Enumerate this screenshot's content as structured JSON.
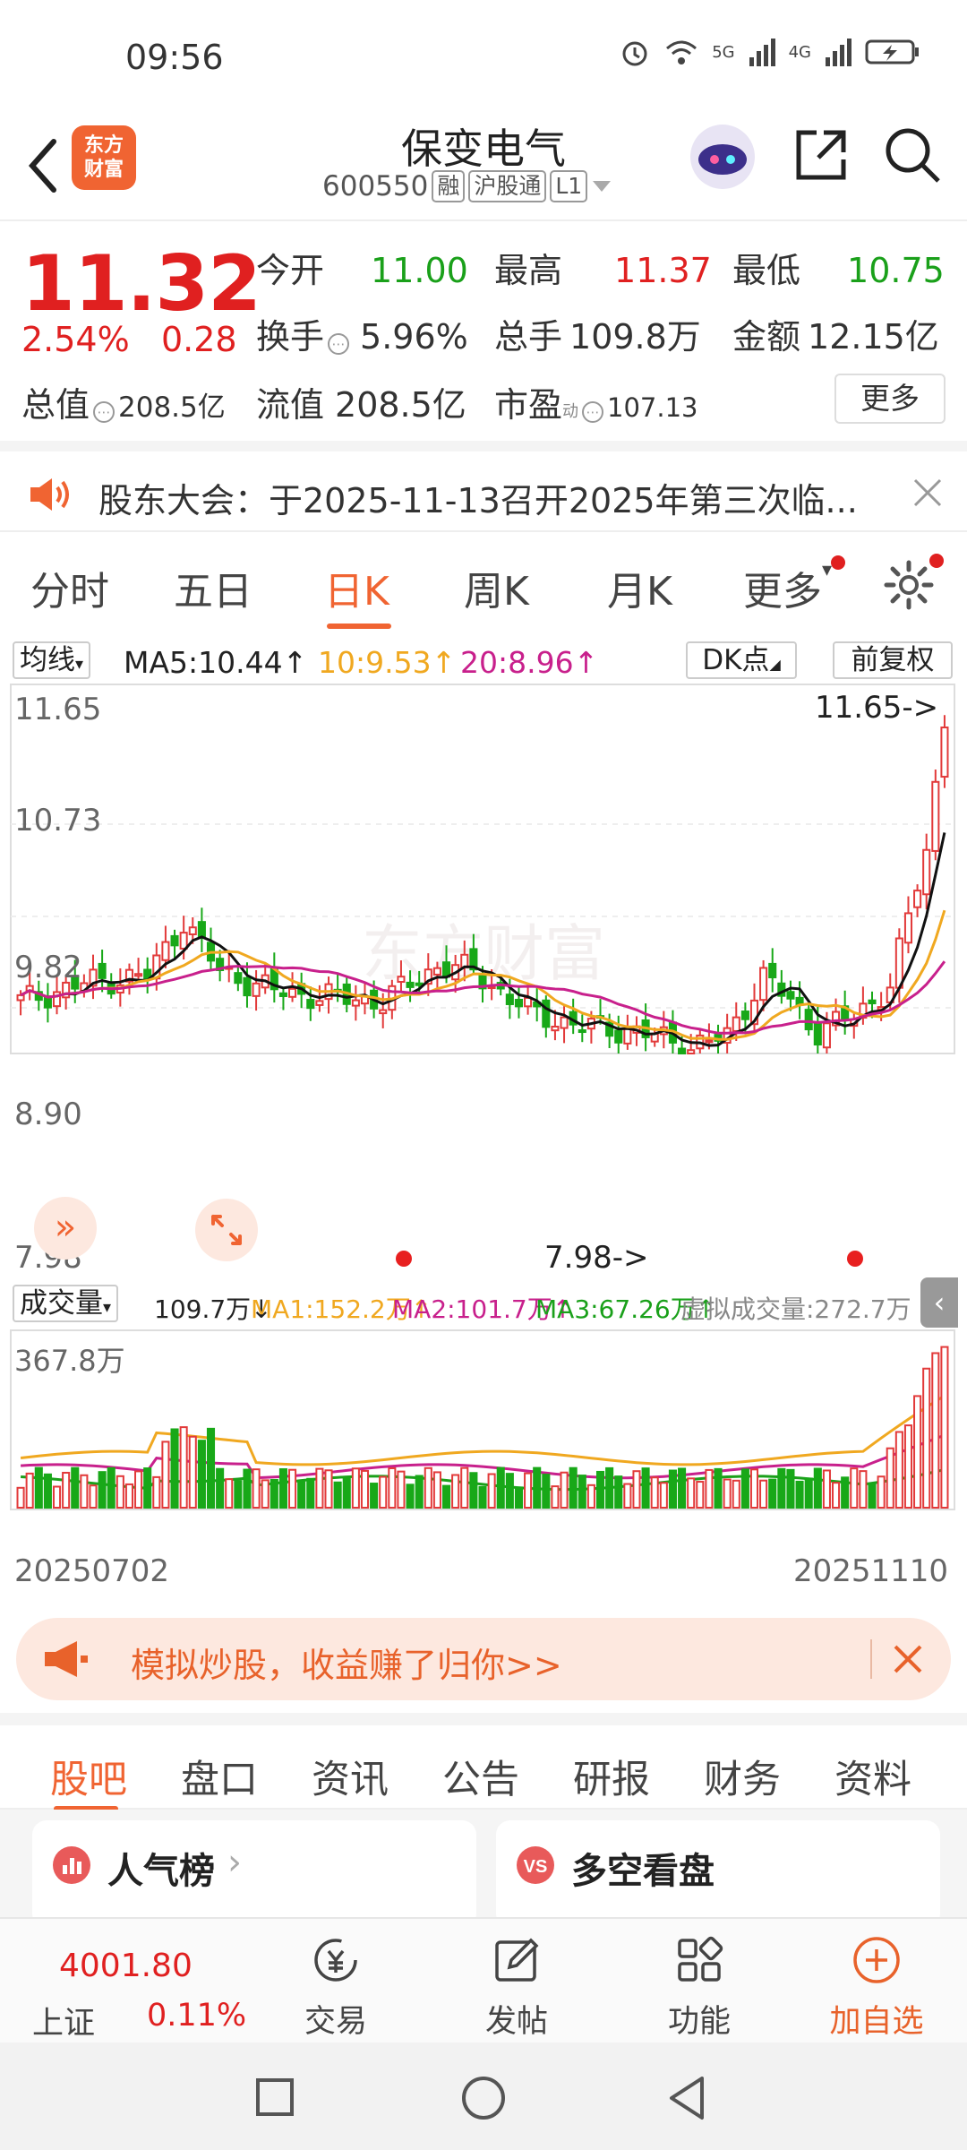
{
  "status": {
    "time": "09:56",
    "net1": "5G",
    "net2": "4G"
  },
  "header": {
    "logo_line1": "东方",
    "logo_line2": "财富",
    "title": "保变电气",
    "code": "600550",
    "tag1": "融",
    "tag2": "沪股通",
    "tag3": "L1"
  },
  "quote": {
    "price": "11.32",
    "pct": "2.54%",
    "chg": "0.28",
    "open_label": "今开",
    "open": "11.00",
    "high_label": "最高",
    "high": "11.37",
    "low_label": "最低",
    "low": "10.75",
    "turnover_label": "换手",
    "turnover": "5.96%",
    "volume_label": "总手",
    "volume": "109.8万",
    "amount_label": "金额",
    "amount": "12.15亿",
    "mcap_label": "总值",
    "mcap": "208.5亿",
    "float_label": "流值",
    "float": "208.5亿",
    "pe_label": "市盈",
    "pe_sup": "动",
    "pe": "107.13",
    "more": "更多"
  },
  "notice": {
    "text": "股东大会：于2025-11-13召开2025年第三次临..."
  },
  "tabs": [
    "分时",
    "五日",
    "日K",
    "周K",
    "月K",
    "更多"
  ],
  "chart": {
    "ma_select": "均线",
    "ma5": "MA5:10.44↑",
    "ma10": "10:9.53↑",
    "ma20": "20:8.96↑",
    "dk": "DK点",
    "fq": "前复权",
    "price_ticks": [
      "11.65",
      "10.73",
      "9.82",
      "8.90",
      "7.98"
    ],
    "max_label": "11.65->",
    "min_label": "7.98->",
    "watermark": "东方财富",
    "vol_select": "成交量",
    "vol_val": "109.7万↓",
    "vol_ma1": "MA1:152.2万↑",
    "vol_ma2": "MA2:101.7万↑",
    "vol_ma3": "MA3:67.26万↑",
    "vol_virtual": "虚拟成交量:272.7万",
    "vol_max": "367.8万",
    "date_start": "20250702",
    "date_end": "20251110",
    "colors": {
      "up": "#e23a3a",
      "down": "#18a818",
      "ma5": "#111111",
      "ma10": "#f0a820",
      "ma20": "#c8208c"
    }
  },
  "banner": {
    "text": "模拟炒股，收益赚了归你>>"
  },
  "ftabs": [
    "股吧",
    "盘口",
    "资讯",
    "公告",
    "研报",
    "财务",
    "资料"
  ],
  "cards": {
    "left": "人气榜",
    "right": "多空看盘"
  },
  "bottomnav": {
    "index_val": "4001.80",
    "index_name": "上证",
    "index_pct": "0.11%",
    "trade": "交易",
    "post": "发帖",
    "func": "功能",
    "add": "加自选"
  }
}
